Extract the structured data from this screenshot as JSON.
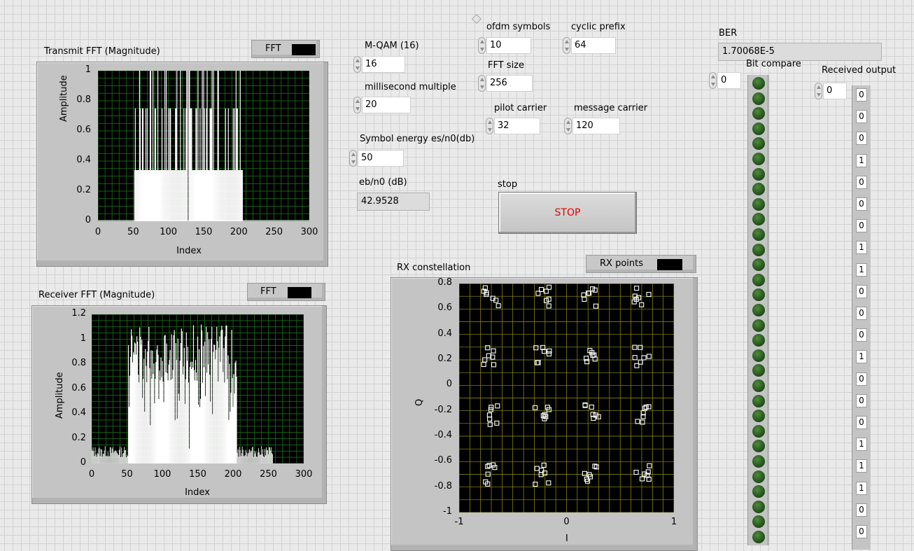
{
  "colors": {
    "plot_bg": "#000000",
    "grid_green": "#2aa52a",
    "grid_yellow": "#c8c822",
    "trace": "#ffffff",
    "stop_text": "#e00000",
    "led_off": "#2d5e22"
  },
  "transmit_graph": {
    "title": "Transmit FFT (Magnitude)",
    "legend_label": "FFT",
    "xlabel": "Index",
    "ylabel": "Amplitude",
    "x_ticks": [
      "0",
      "50",
      "100",
      "150",
      "200",
      "250",
      "300"
    ],
    "y_ticks": [
      "0",
      "0.2",
      "0.4",
      "0.6",
      "0.8",
      "1"
    ],
    "chart_data": {
      "type": "line",
      "xlim": [
        0,
        300
      ],
      "ylim": [
        0,
        1
      ],
      "occupied_range": [
        52,
        205
      ],
      "levels": [
        0.34,
        0.75,
        1.0
      ],
      "zero_bins": [
        128
      ]
    }
  },
  "receiver_graph": {
    "title": "Receiver FFT (Magnitude)",
    "legend_label": "FFT",
    "xlabel": "Index",
    "ylabel": "Amplitude",
    "x_ticks": [
      "0",
      "50",
      "100",
      "150",
      "200",
      "250",
      "300"
    ],
    "y_ticks": [
      "0",
      "0.2",
      "0.4",
      "0.6",
      "0.8",
      "1",
      "1.2"
    ],
    "chart_data": {
      "type": "line",
      "xlim": [
        0,
        300
      ],
      "ylim": [
        0,
        1.2
      ],
      "signal_range": [
        52,
        205
      ],
      "noise_floor": 0.1,
      "data_end": 256
    }
  },
  "constellation": {
    "title": "RX constellation",
    "legend_label": "RX points",
    "xlabel": "I",
    "ylabel": "Q",
    "x_ticks": [
      "-1",
      "0",
      "1"
    ],
    "y_ticks": [
      "0.8",
      "0.6",
      "0.4",
      "0.2",
      "0",
      "-0.2",
      "-0.4",
      "-0.6",
      "-0.8",
      "-1"
    ],
    "chart_data": {
      "type": "scatter",
      "xlim": [
        -1,
        1
      ],
      "ylim": [
        -1,
        0.8
      ],
      "ideal_points": [
        -0.7,
        -0.23,
        0.23,
        0.7
      ],
      "spread": 0.06
    }
  },
  "controls": {
    "mqam": {
      "label": "M-QAM (16)",
      "value": "16"
    },
    "ms_multiple": {
      "label": "millisecond multiple",
      "value": "20"
    },
    "esn0": {
      "label": "Symbol energy es/n0(db)",
      "value": "50"
    },
    "ebn0": {
      "label": "eb/n0 (dB)",
      "value": "42.9528"
    },
    "ofdm_symbols": {
      "label": "ofdm symbols",
      "value": "10"
    },
    "cyclic_prefix": {
      "label": "cyclic prefix",
      "value": "64"
    },
    "fft_size": {
      "label": "FFT size",
      "value": "256"
    },
    "pilot_carrier": {
      "label": "pilot carrier",
      "value": "32"
    },
    "message_carrier": {
      "label": "message carrier",
      "value": "120"
    },
    "stop": {
      "label": "stop",
      "button_text": "STOP"
    }
  },
  "ber": {
    "label": "BER",
    "value": "1.70068E-5"
  },
  "bit_compare": {
    "label": "Bit compare",
    "index": "0",
    "leds": [
      false,
      false,
      false,
      false,
      false,
      false,
      false,
      false,
      false,
      false,
      false,
      false,
      false,
      false,
      false,
      false,
      false,
      false,
      false,
      false,
      false,
      false,
      false,
      false,
      false,
      false,
      false,
      false,
      false,
      false,
      false
    ]
  },
  "received_output": {
    "label": "Received output",
    "index": "0",
    "values": [
      "0",
      "0",
      "0",
      "1",
      "0",
      "0",
      "0",
      "1",
      "1",
      "0",
      "0",
      "0",
      "1",
      "0",
      "0",
      "0",
      "1",
      "1",
      "1",
      "0",
      "0"
    ]
  }
}
